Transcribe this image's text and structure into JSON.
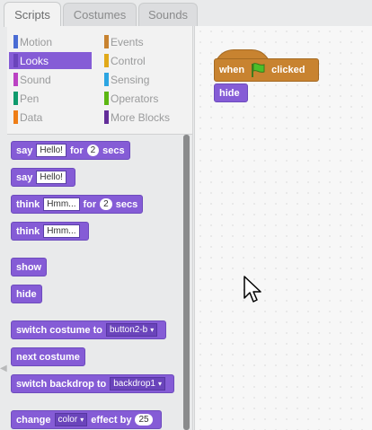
{
  "tabs": {
    "scripts": "Scripts",
    "costumes": "Costumes",
    "sounds": "Sounds"
  },
  "categories": {
    "motion": "Motion",
    "looks": "Looks",
    "sound": "Sound",
    "pen": "Pen",
    "data": "Data",
    "events": "Events",
    "control": "Control",
    "sensing": "Sensing",
    "operators": "Operators",
    "more": "More Blocks"
  },
  "category_colors": {
    "motion": "#4a6cd4",
    "looks": "#855cd6",
    "sound": "#bb42c3",
    "pen": "#0e9a6c",
    "data": "#ee7d16",
    "events": "#c88330",
    "control": "#e1a91a",
    "sensing": "#2ca5e2",
    "operators": "#5cb712",
    "more": "#632d99"
  },
  "blocks": {
    "say_for": {
      "say": "say",
      "text": "Hello!",
      "for": "for",
      "secs_val": "2",
      "secs": "secs"
    },
    "say": {
      "say": "say",
      "text": "Hello!"
    },
    "think_for": {
      "think": "think",
      "text": "Hmm...",
      "for": "for",
      "secs_val": "2",
      "secs": "secs"
    },
    "think": {
      "think": "think",
      "text": "Hmm..."
    },
    "show": "show",
    "hide": "hide",
    "switch_costume": {
      "label": "switch costume to",
      "value": "button2-b"
    },
    "next_costume": "next costume",
    "switch_backdrop": {
      "label": "switch backdrop to",
      "value": "backdrop1"
    },
    "change_effect": {
      "change": "change",
      "effect": "color",
      "effect_label": "effect by",
      "value": "25"
    }
  },
  "script": {
    "when": "when",
    "clicked": "clicked",
    "hide": "hide"
  }
}
